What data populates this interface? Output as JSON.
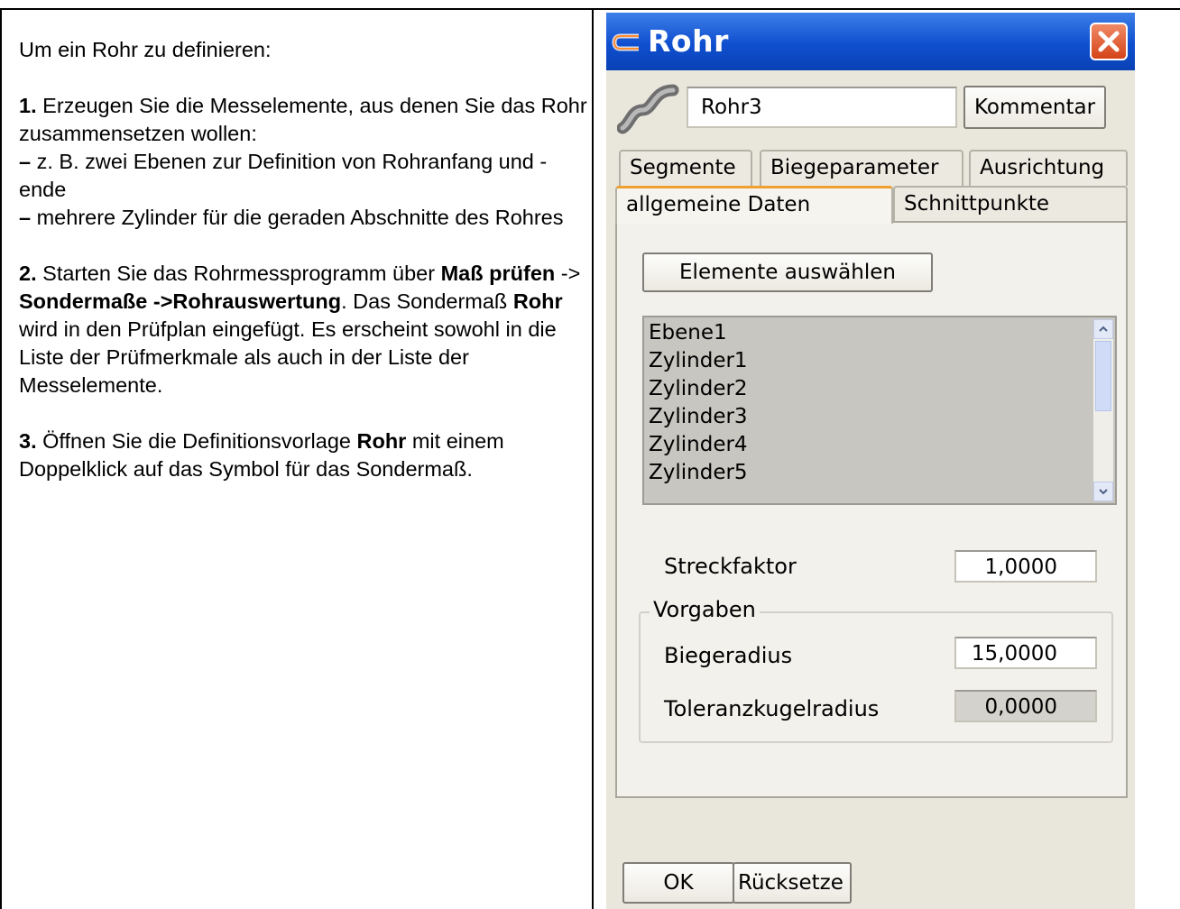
{
  "instructions": {
    "intro": "Um ein Rohr zu definieren:",
    "step1_num": "1.",
    "step1_text": " Erzeugen Sie die Messelemente, aus denen Sie das Rohr zusammensetzen wollen:",
    "step1_b1_dash": "–",
    "step1_b1_text": " z. B. zwei Ebenen zur Definition von Rohranfang und -ende",
    "step1_b2_dash": "–",
    "step1_b2_text": " mehrere Zylinder für die geraden Abschnitte des Rohres",
    "step2_num": "2.",
    "step2_a": " Starten Sie das Rohrmessprogramm über ",
    "step2_b1": "Maß prüfen",
    "step2_c": " -> ",
    "step2_b2": "Sondermaße ->Rohrauswertung",
    "step2_d": ". Das Sondermaß ",
    "step2_b3": "Rohr",
    "step2_e": " wird in den Prüfplan eingefügt. Es erscheint sowohl in die Liste der Prüfmerkmale als auch in der Liste der Messelemente.",
    "step3_num": "3.",
    "step3_a": " Öffnen Sie die Definitionsvorlage ",
    "step3_b": "Rohr",
    "step3_c": " mit einem Doppelklick auf das Symbol für das Sondermaß."
  },
  "dialog": {
    "title": "Rohr",
    "name_value": "Rohr3",
    "comment_button": "Kommentar",
    "tabs_row1": [
      "Segmente",
      "Biegeparameter",
      "Ausrichtung"
    ],
    "tabs_row2": [
      "allgemeine Daten",
      "Schnittpunkte"
    ],
    "select_button": "Elemente auswählen",
    "elements": [
      "Ebene1",
      "Zylinder1",
      "Zylinder2",
      "Zylinder3",
      "Zylinder4",
      "Zylinder5"
    ],
    "stretch_label": "Streckfaktor",
    "stretch_value": "1,0000",
    "group_label": "Vorgaben",
    "bend_radius_label": "Biegeradius",
    "bend_radius_value": "15,0000",
    "tolerance_label": "Toleranzkugelradius",
    "tolerance_value": "0,0000",
    "ok_button": "OK",
    "reset_button": "Rücksetze"
  },
  "colors": {
    "titlebar": "#0f4fcf",
    "close_button": "#d44318",
    "list_background": "#c8c6c0",
    "active_tab_accent": "#f0a030"
  }
}
